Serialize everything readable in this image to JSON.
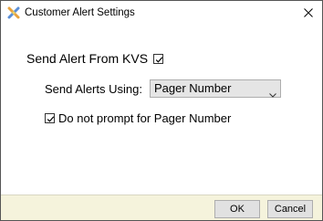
{
  "window": {
    "title": "Customer Alert Settings",
    "icon": "kvs-app-icon",
    "close_icon": "close-icon"
  },
  "form": {
    "send_alert_from_kvs": {
      "label": "Send Alert From KVS",
      "checked": true
    },
    "send_alerts_using": {
      "label": "Send Alerts Using:",
      "selected": "Pager Number"
    },
    "no_prompt_pager": {
      "label": "Do not prompt for Pager Number",
      "checked": true
    }
  },
  "footer": {
    "ok_label": "OK",
    "cancel_label": "Cancel",
    "background_color": "#f5f3dc"
  }
}
